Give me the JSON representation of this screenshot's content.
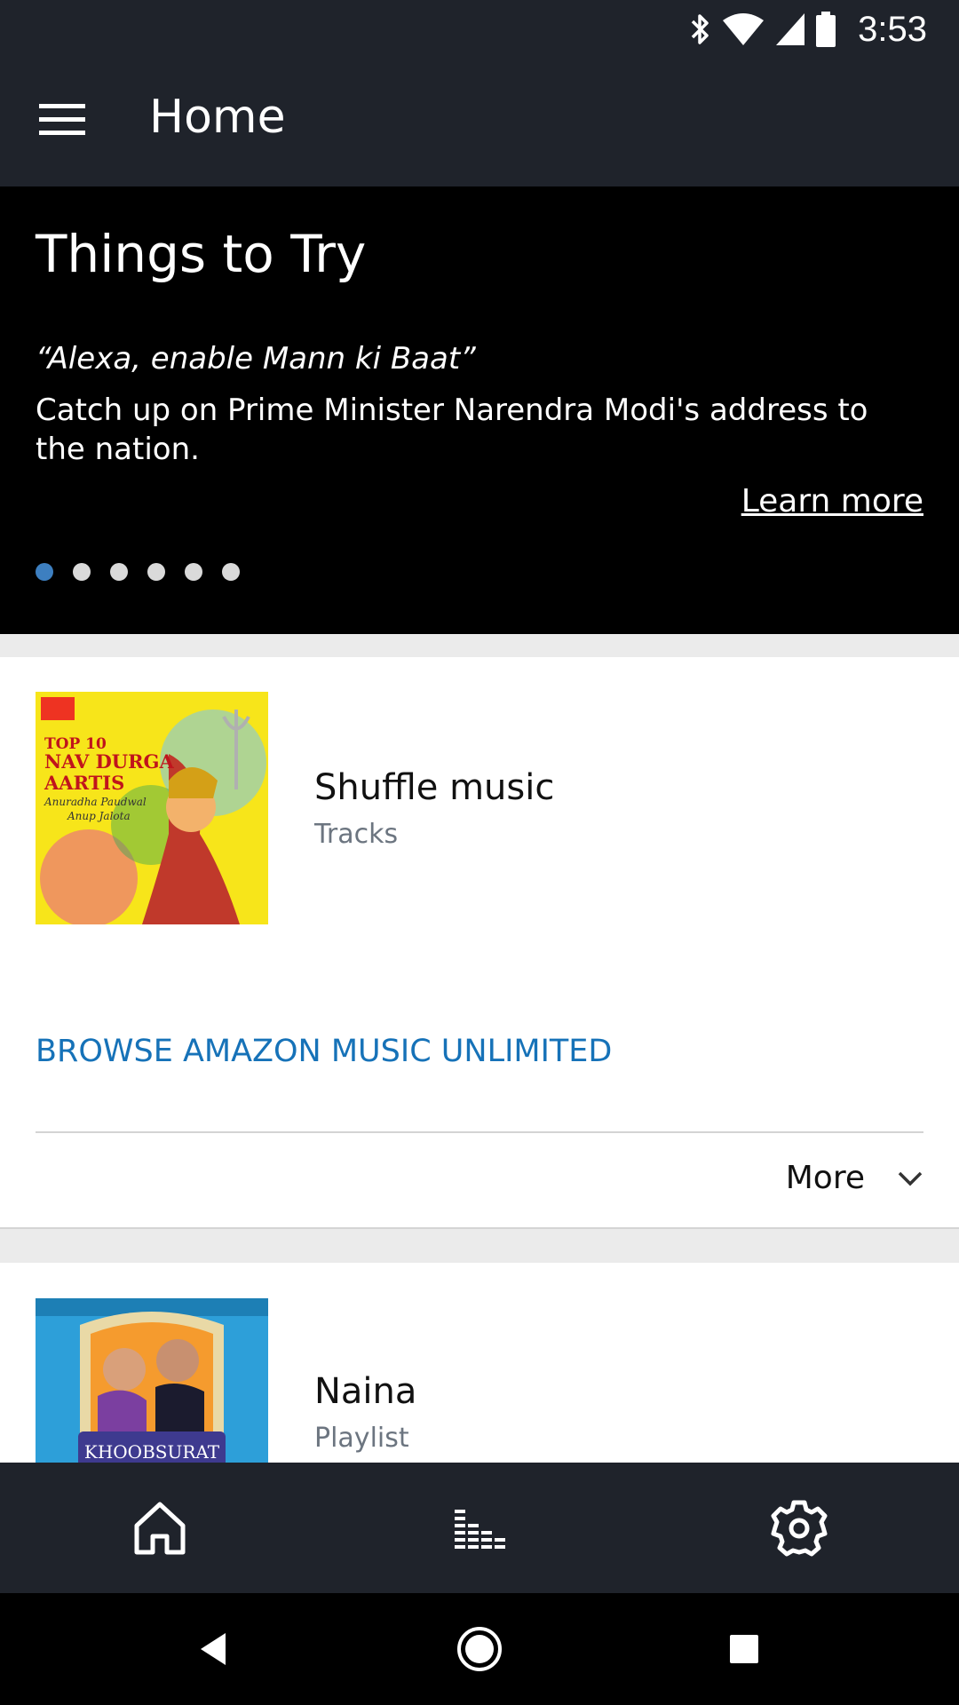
{
  "status_bar": {
    "time": "3:53",
    "icons": [
      "bluetooth-icon",
      "wifi-icon",
      "cell-signal-icon",
      "battery-icon"
    ]
  },
  "app_bar": {
    "title": "Home",
    "menu_icon": "hamburger-menu-icon"
  },
  "carousel": {
    "heading": "Things to Try",
    "quote": "“Alexa, enable Mann ki Baat”",
    "description": "Catch up on Prime Minister Narendra Modi's address to the nation.",
    "learn_more": "Learn more",
    "page_count": 6,
    "active_page": 1
  },
  "music_card": {
    "title": "Shuffle music",
    "subtitle": "Tracks",
    "cover_text": {
      "line1": "TOP 10",
      "line2": "NAV DURGA",
      "line3": "AARTIS",
      "line4": "Anuradha Paudwal",
      "line5": "Anup Jalota"
    },
    "browse_link": "BROWSE AMAZON MUSIC UNLIMITED",
    "more_label": "More"
  },
  "playlist_card": {
    "title": "Naina",
    "subtitle": "Playlist",
    "cover_text": "KHOOBSURAT"
  },
  "bottom_nav": {
    "items": [
      "home-icon",
      "equalizer-icon",
      "settings-gear-icon"
    ]
  },
  "colors": {
    "app_bar": "#1f232b",
    "accent_link": "#1672b8",
    "active_dot": "#3d7fc0",
    "secondary_text": "#6c7580"
  }
}
